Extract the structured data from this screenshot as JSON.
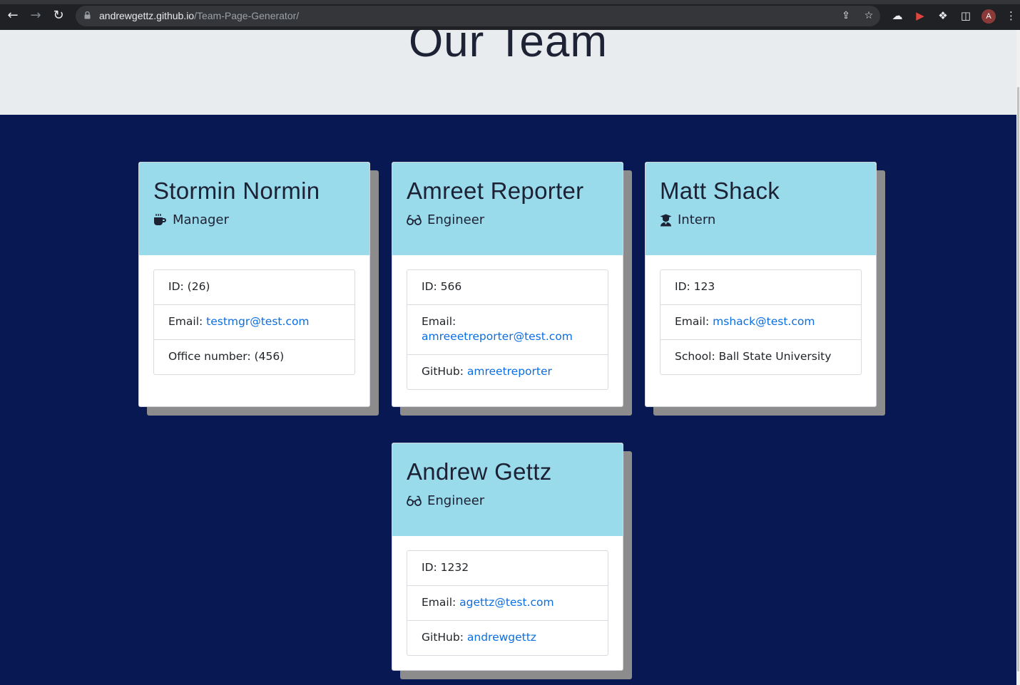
{
  "browser": {
    "url_host": "andrewgettz.github.io",
    "url_path": "/Team-Page-Generator/",
    "avatar_letter": "A"
  },
  "header": {
    "title": "Our Team"
  },
  "team": [
    {
      "name": "Stormin Normin",
      "role": "Manager",
      "role_icon": "coffee-icon",
      "id_label": "ID: ",
      "id": "(26)",
      "email_label": "Email: ",
      "email": "testmgr@test.com",
      "extra_label": "Office number: ",
      "extra_value": "(456)"
    },
    {
      "name": "Amreet Reporter",
      "role": "Engineer",
      "role_icon": "glasses-icon",
      "id_label": "ID: ",
      "id": "566",
      "email_label": "Email:",
      "email": "amreeetreporter@test.com",
      "extra_label": "GitHub: ",
      "extra_value": "amreetreporter"
    },
    {
      "name": "Matt Shack",
      "role": "Intern",
      "role_icon": "graduate-icon",
      "id_label": "ID: ",
      "id": "123",
      "email_label": "Email: ",
      "email": "mshack@test.com",
      "extra_label": "School: ",
      "extra_value": "Ball State University"
    },
    {
      "name": "Andrew Gettz",
      "role": "Engineer",
      "role_icon": "glasses-icon",
      "id_label": "ID: ",
      "id": "1232",
      "email_label": "Email: ",
      "email": "agettz@test.com",
      "extra_label": "GitHub: ",
      "extra_value": "andrewgettz"
    }
  ]
}
